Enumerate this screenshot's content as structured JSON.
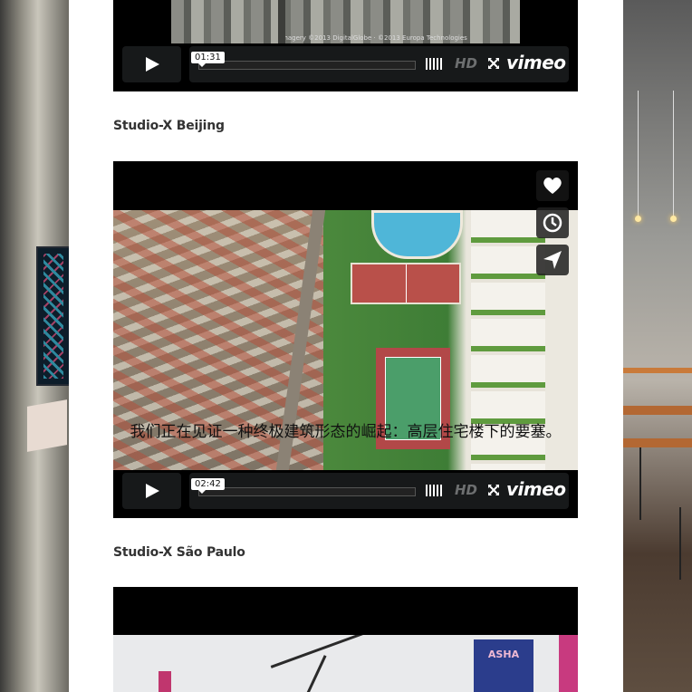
{
  "captions": {
    "beijing": "Studio-X Beijing",
    "sao_paulo": "Studio-X São Paulo"
  },
  "videos": [
    {
      "time": "01:31",
      "thumb_credit": "Imagery ©2013 DigitalGlobe · ©2013 Europa Technologies"
    },
    {
      "time": "02:42",
      "subtitle": "我们正在见证一种终极建筑形态的崛起：高层住宅楼下的要塞。",
      "side_buttons": [
        "heart-icon",
        "clock-icon",
        "send-icon"
      ]
    },
    {
      "sign_text": "ASHA"
    }
  ],
  "controls": {
    "hd_label": "HD",
    "brand_label": "vimeo",
    "play_icon": "play-icon",
    "volume_icon": "volume-icon",
    "fullscreen_icon": "fullscreen-icon"
  },
  "colors": {
    "control_bg": "#17191a",
    "hd_inactive": "#6d6f70",
    "page_bg": "#ffffff",
    "caption": "#333333"
  }
}
